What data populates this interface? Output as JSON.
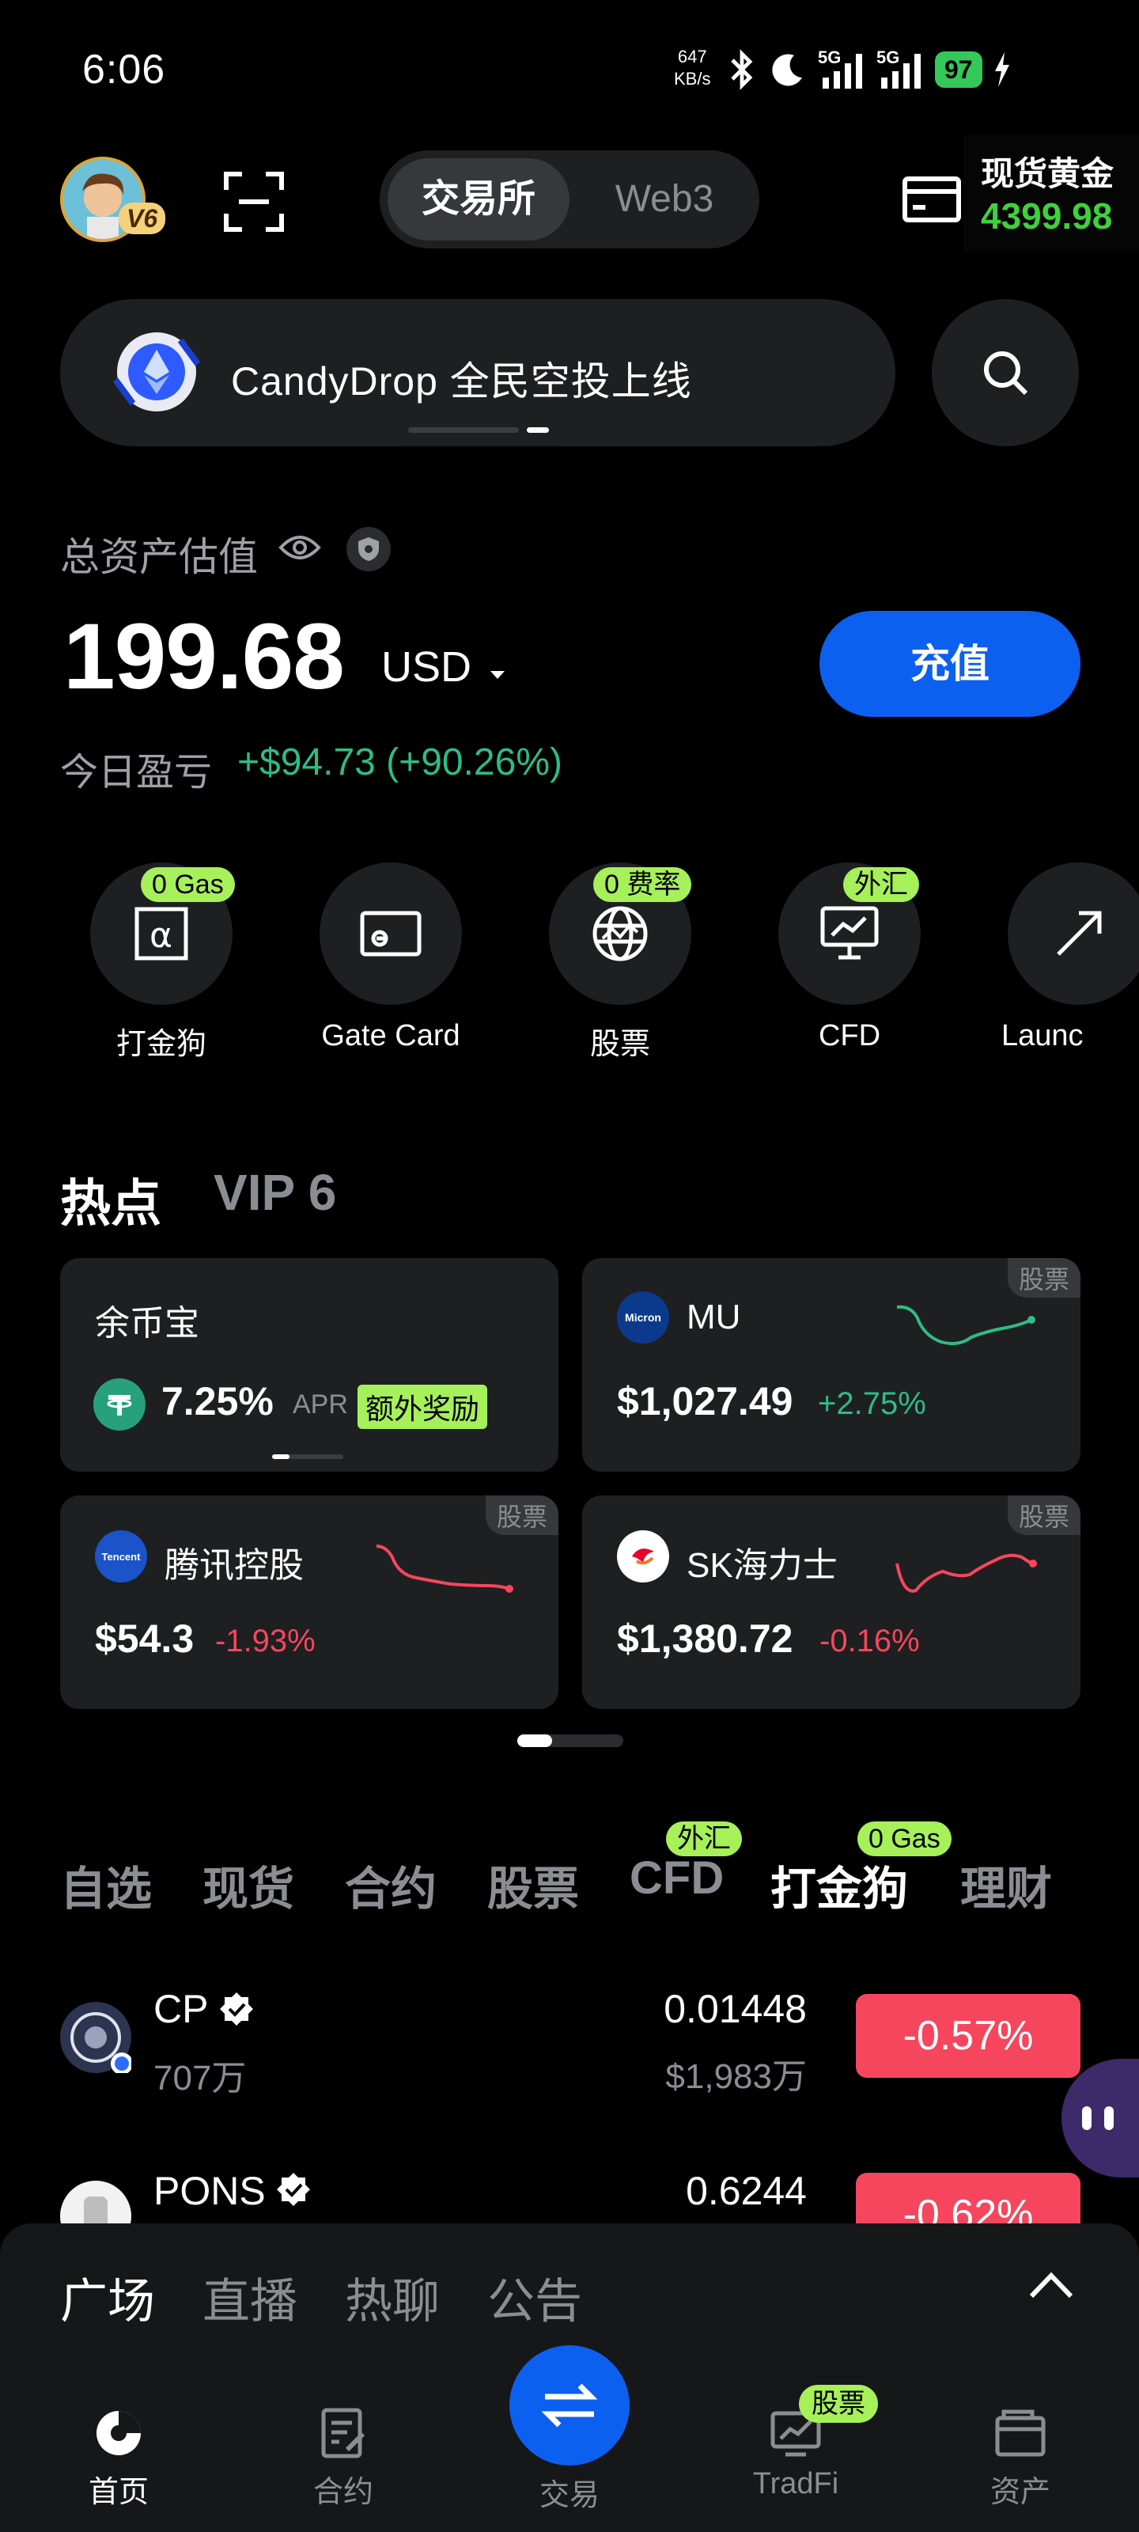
{
  "status_bar": {
    "time": "6:06",
    "net_speed_value": "647",
    "net_speed_unit": "KB/s",
    "sim1": "5G",
    "sim2": "5G",
    "battery": "97"
  },
  "header": {
    "avatar_badge": "V6",
    "tabs": [
      "交易所",
      "Web3"
    ],
    "active_tab": "交易所",
    "gold_label": "现货黄金",
    "gold_price": "4399.98"
  },
  "banner": {
    "text": "CandyDrop 全民空投上线"
  },
  "assets": {
    "label": "总资产估值",
    "amount": "199.68",
    "currency": "USD",
    "deposit_label": "充值",
    "pnl_label": "今日盈亏",
    "pnl_value": "+$94.73 (+90.26%)"
  },
  "shortcuts": [
    {
      "label": "打金狗",
      "tag": "0 Gas",
      "icon": "alpha-icon"
    },
    {
      "label": "Gate Card",
      "tag": "",
      "icon": "card-icon"
    },
    {
      "label": "股票",
      "tag": "0 费率",
      "icon": "globe-icon"
    },
    {
      "label": "CFD",
      "tag": "外汇",
      "icon": "chart-monitor-icon"
    },
    {
      "label": "Launc",
      "tag": "",
      "icon": "launch-icon"
    }
  ],
  "hot": {
    "title": "热点",
    "vip_title": "VIP 6",
    "cards": [
      {
        "name": "余币宝",
        "value": "7.25%",
        "unit": "APR",
        "bonus": "额外奖励"
      },
      {
        "name": "MU",
        "price": "$1,027.49",
        "change": "+2.75%",
        "tag": "股票"
      },
      {
        "name": "腾讯控股",
        "price": "$54.3",
        "change": "-1.93%",
        "tag": "股票",
        "logo_text": "Tencent"
      },
      {
        "name": "SK海力士",
        "price": "$1,380.72",
        "change": "-0.16%",
        "tag": "股票"
      }
    ],
    "mu_logo_text": "Micron"
  },
  "market_tabs": [
    {
      "label": "自选",
      "tag": ""
    },
    {
      "label": "现货",
      "tag": ""
    },
    {
      "label": "合约",
      "tag": ""
    },
    {
      "label": "股票",
      "tag": ""
    },
    {
      "label": "CFD",
      "tag": "外汇"
    },
    {
      "label": "打金狗",
      "tag": "0 Gas"
    },
    {
      "label": "理财",
      "tag": ""
    }
  ],
  "active_market_tab": "打金狗",
  "market_list": [
    {
      "name": "CP",
      "volume": "707万",
      "price": "0.01448",
      "price_usd": "$1,983万",
      "change": "-0.57%"
    },
    {
      "name": "PONS",
      "volume": "",
      "price": "0.6244",
      "price_usd": "",
      "change": "-0.62%"
    }
  ],
  "community_tabs": [
    "广场",
    "直播",
    "热聊",
    "公告"
  ],
  "bottom_nav": [
    {
      "label": "首页",
      "icon": "home-icon"
    },
    {
      "label": "合约",
      "icon": "contract-icon"
    },
    {
      "label": "交易",
      "icon": "swap-icon"
    },
    {
      "label": "TradFi",
      "icon": "tradfi-icon",
      "tag": "股票"
    },
    {
      "label": "资产",
      "icon": "wallet-icon"
    }
  ],
  "colors": {
    "accent_blue": "#0c60f0",
    "up_green": "#2dbd85",
    "down_red": "#f6465d",
    "tag_lime": "#a6f05a"
  }
}
